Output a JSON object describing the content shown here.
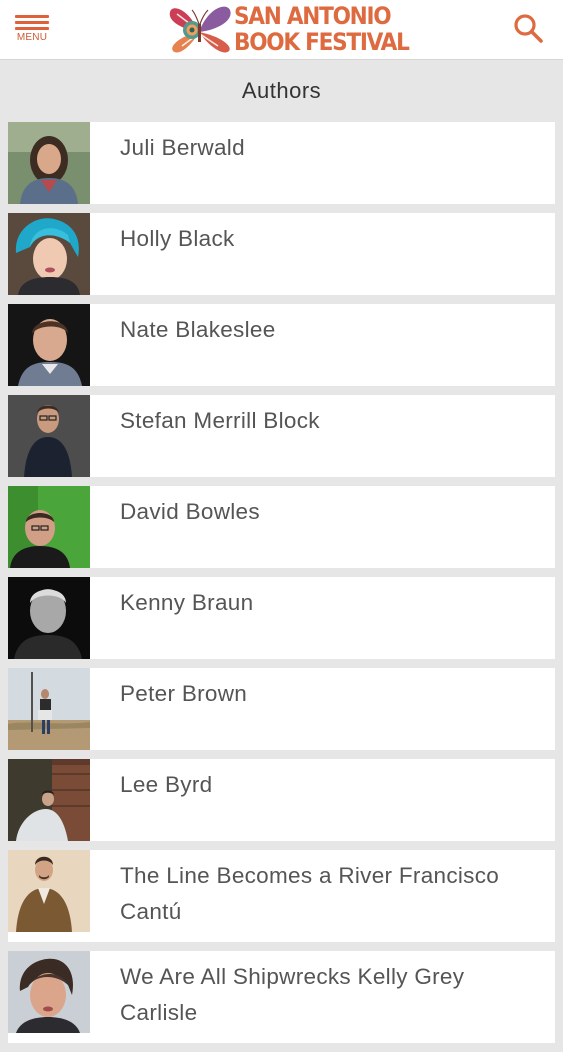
{
  "header": {
    "menu_label": "MENU",
    "logo_line1": "SAN ANTONIO",
    "logo_line2": "BOOK FESTIVAL",
    "search_icon": "search-icon",
    "accent_color": "#de6a40"
  },
  "page_title": "Authors",
  "authors": [
    {
      "name": "Juli Berwald"
    },
    {
      "name": "Holly Black"
    },
    {
      "name": "Nate Blakeslee"
    },
    {
      "name": "Stefan Merrill Block"
    },
    {
      "name": "David Bowles"
    },
    {
      "name": "Kenny Braun"
    },
    {
      "name": "Peter Brown"
    },
    {
      "name": "Lee Byrd"
    },
    {
      "name": "The Line Becomes a River Francisco Cantú"
    },
    {
      "name": "We Are All Shipwrecks Kelly Grey Carlisle"
    }
  ]
}
